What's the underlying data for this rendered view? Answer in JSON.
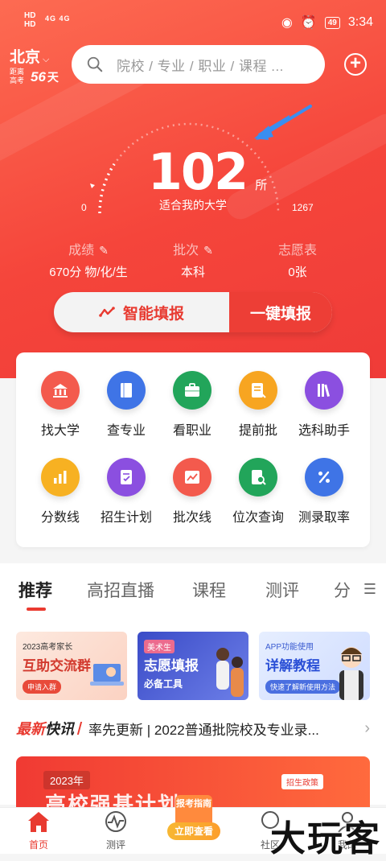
{
  "status_bar": {
    "left_top": "HD",
    "left_bottom": "HD",
    "signal": "4G 4G",
    "battery": "49",
    "time": "3:34"
  },
  "location": {
    "city": "北京",
    "exam_prefix_1": "距离",
    "exam_prefix_2": "高考",
    "days": "56",
    "days_unit": "天"
  },
  "search": {
    "placeholder": "院校 / 专业 / 职业 / 课程 ..."
  },
  "gauge": {
    "count": "102",
    "unit": "所",
    "subtitle": "适合我的大学",
    "min": "0",
    "max": "1267"
  },
  "stats": [
    {
      "label": "成绩",
      "value": "670分 物/化/生"
    },
    {
      "label": "批次",
      "value": "本科"
    },
    {
      "label": "志愿表",
      "value": "0张"
    }
  ],
  "actions": {
    "smart": "智能填报",
    "one_click": "一键填报"
  },
  "grid": [
    {
      "label": "找大学",
      "color": "#f35a4d",
      "icon": "university-icon"
    },
    {
      "label": "查专业",
      "color": "#3f74e6",
      "icon": "book-icon"
    },
    {
      "label": "看职业",
      "color": "#22a55a",
      "icon": "briefcase-icon"
    },
    {
      "label": "提前批",
      "color": "#f7a521",
      "icon": "document-icon"
    },
    {
      "label": "选科助手",
      "color": "#8b4fe0",
      "icon": "books-icon"
    },
    {
      "label": "分数线",
      "color": "#f7b122",
      "icon": "bar-chart-icon"
    },
    {
      "label": "招生计划",
      "color": "#8b4fe0",
      "icon": "checklist-icon"
    },
    {
      "label": "批次线",
      "color": "#f35a4d",
      "icon": "line-chart-icon"
    },
    {
      "label": "位次查询",
      "color": "#22a55a",
      "icon": "search-doc-icon"
    },
    {
      "label": "测录取率",
      "color": "#3f74e6",
      "icon": "percent-icon"
    }
  ],
  "tabs": [
    {
      "label": "推荐",
      "active": true
    },
    {
      "label": "高招直播"
    },
    {
      "label": "课程"
    },
    {
      "label": "测评"
    },
    {
      "label": "分"
    }
  ],
  "banners": [
    {
      "small": "2023高考家长",
      "title": "互助交流群",
      "pill": "申请入群"
    },
    {
      "small": "美术生",
      "title": "志愿填报",
      "sub": "必备工具"
    },
    {
      "small": "APP功能使用",
      "title": "详解教程",
      "pill": "快速了解新使用方法"
    }
  ],
  "news": {
    "logo_a": "最新",
    "logo_b": "快讯",
    "text": "率先更新 | 2022普通批院校及专业录..."
  },
  "promo": {
    "year": "2023年",
    "title": "高校强基计划",
    "tag": "招生政策"
  },
  "navbar": [
    {
      "label": "首页",
      "active": true
    },
    {
      "label": "测评"
    },
    {
      "label": "社区"
    },
    {
      "label": "我的"
    }
  ],
  "center_button": {
    "top": "报考指南",
    "bottom": "立即查看"
  },
  "watermark": "大玩客",
  "colors": {
    "primary": "#ea3a30",
    "hero_start": "#fd6b52",
    "hero_end": "#ef3b38"
  }
}
